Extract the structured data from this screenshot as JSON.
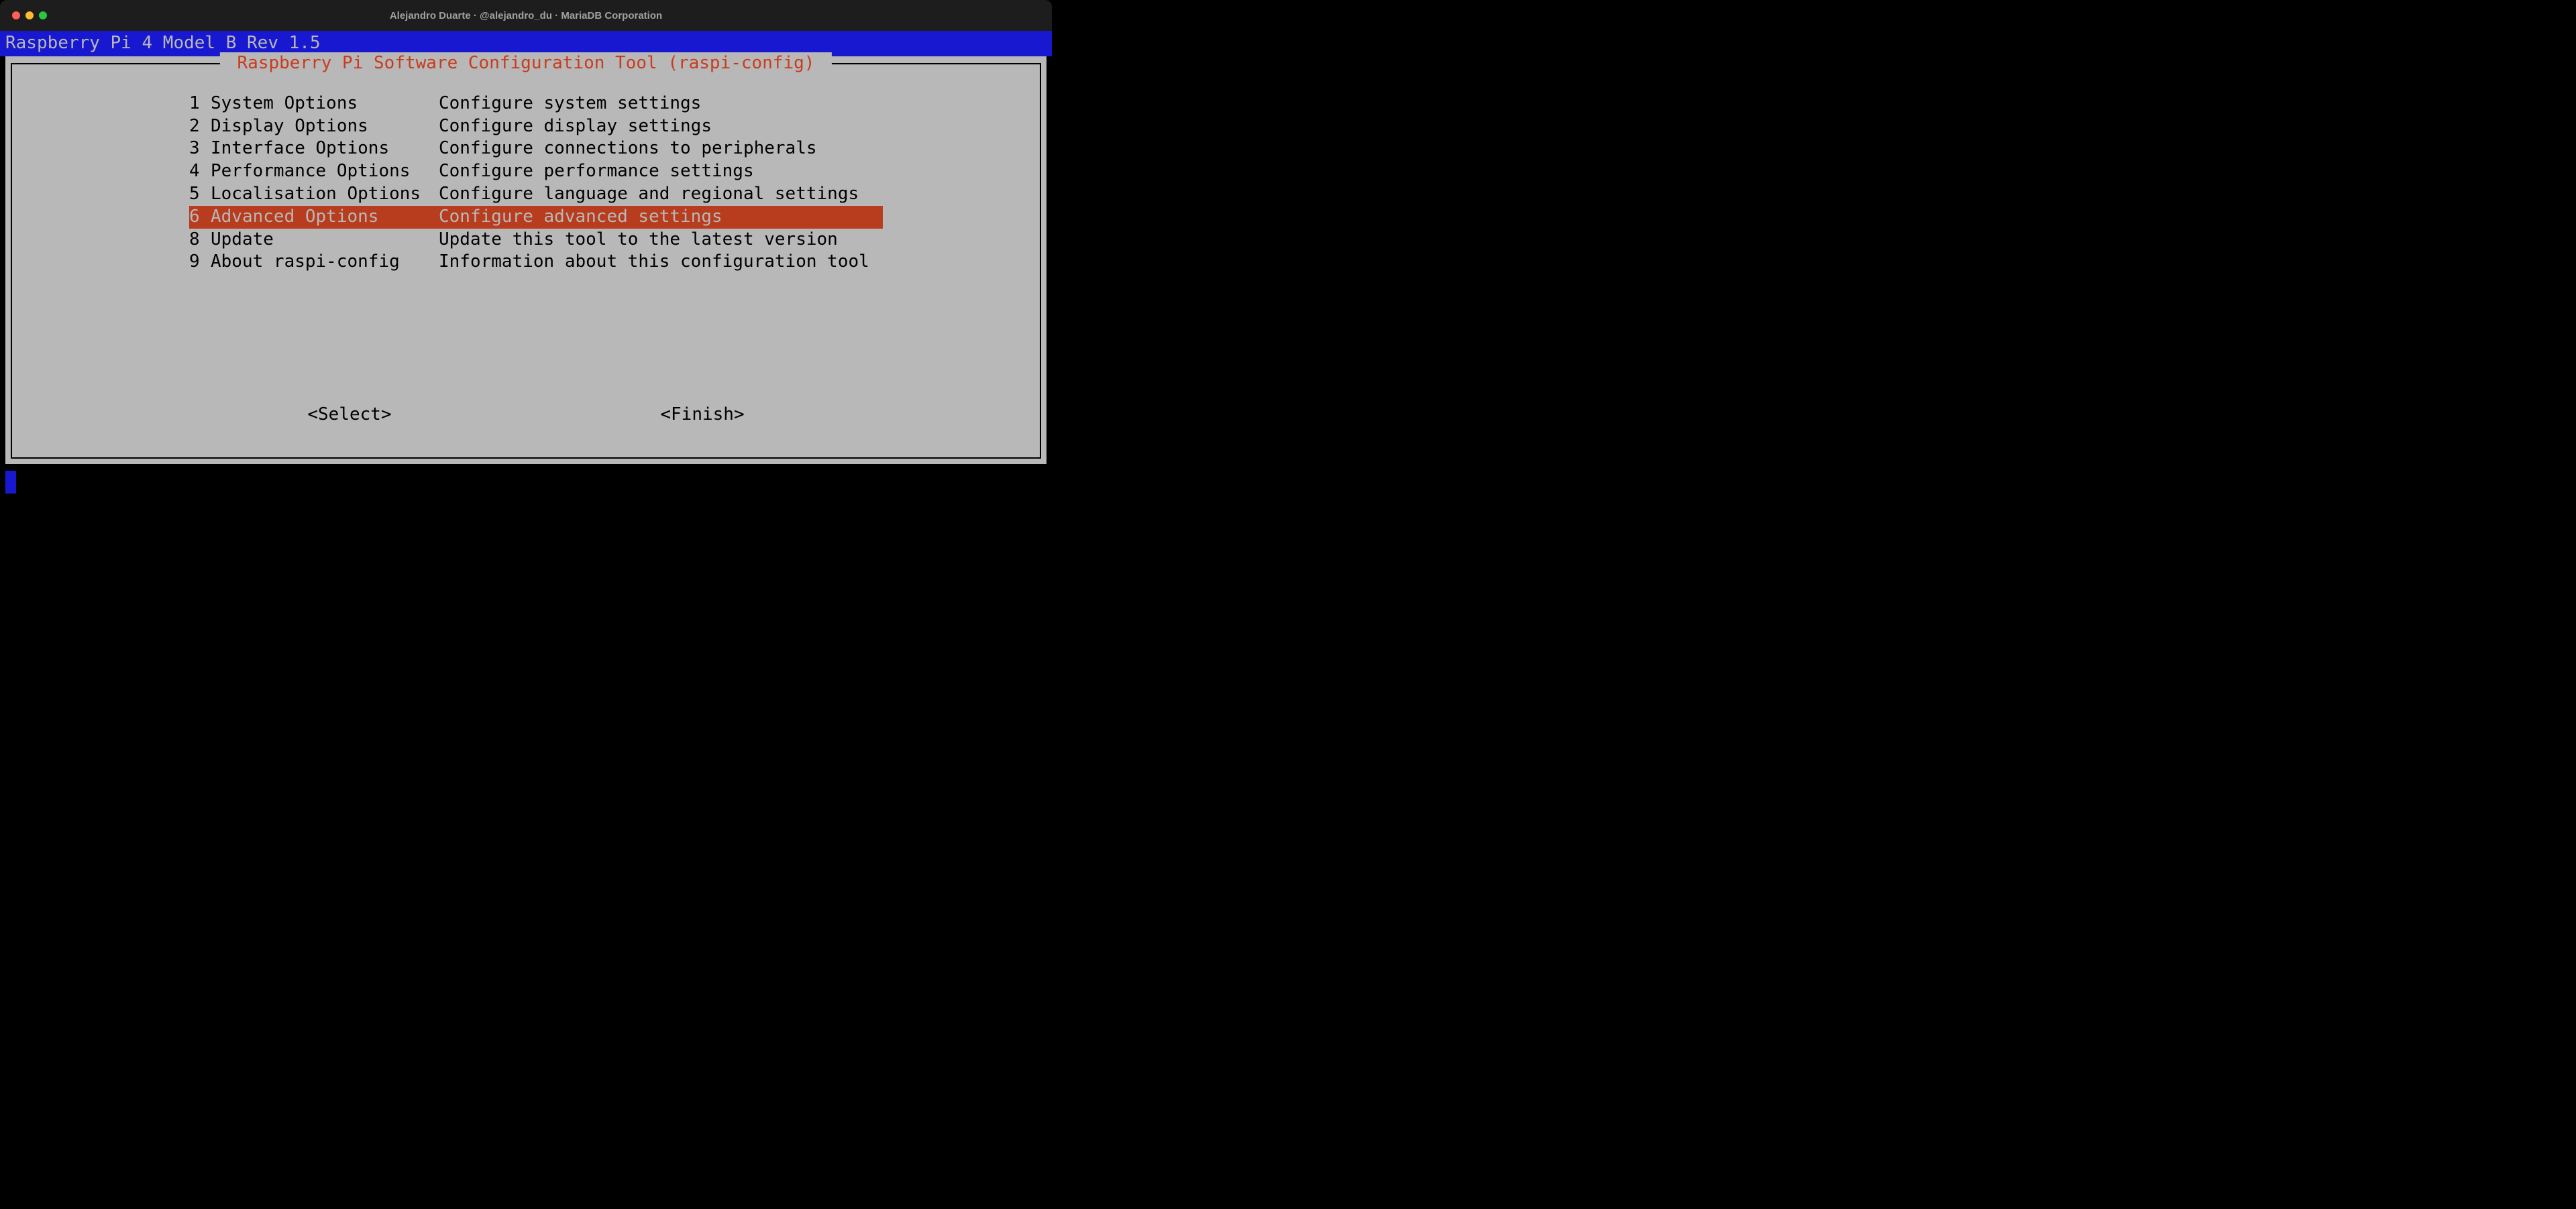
{
  "window": {
    "title": "Alejandro Duarte · @alejandro_du · MariaDB Corporation"
  },
  "header": {
    "device_info": "Raspberry Pi 4 Model B Rev 1.5"
  },
  "dialog": {
    "title": " Raspberry Pi Software Configuration Tool (raspi-config) ",
    "selected_index": 5,
    "items": [
      {
        "num": "1",
        "label": "System Options",
        "desc": "Configure system settings"
      },
      {
        "num": "2",
        "label": "Display Options",
        "desc": "Configure display settings"
      },
      {
        "num": "3",
        "label": "Interface Options",
        "desc": "Configure connections to peripherals"
      },
      {
        "num": "4",
        "label": "Performance Options",
        "desc": "Configure performance settings"
      },
      {
        "num": "5",
        "label": "Localisation Options",
        "desc": "Configure language and regional settings"
      },
      {
        "num": "6",
        "label": "Advanced Options",
        "desc": "Configure advanced settings"
      },
      {
        "num": "8",
        "label": "Update",
        "desc": "Update this tool to the latest version"
      },
      {
        "num": "9",
        "label": "About raspi-config",
        "desc": "Information about this configuration tool"
      }
    ],
    "buttons": {
      "select": "<Select>",
      "finish": "<Finish>"
    }
  }
}
